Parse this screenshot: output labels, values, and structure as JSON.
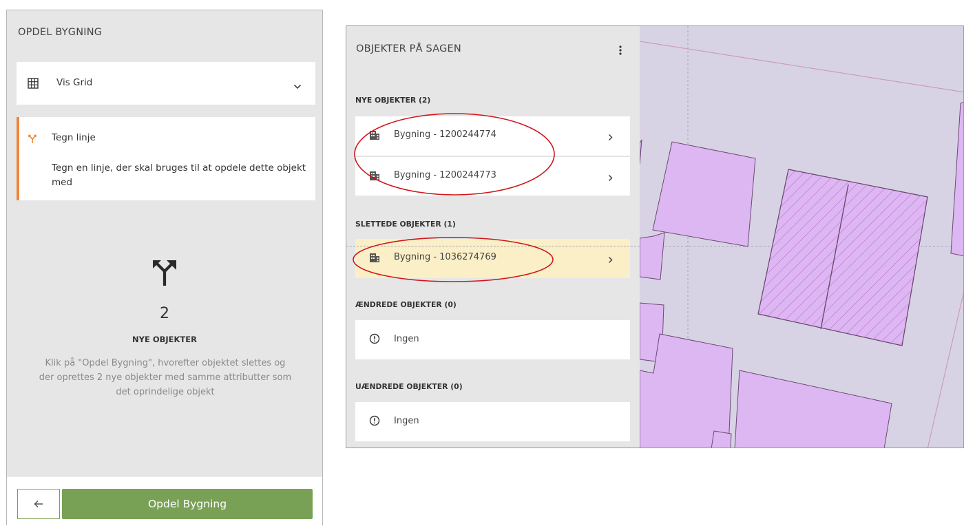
{
  "left_panel": {
    "title": "OPDEL BYGNING",
    "grid_selector": {
      "label": "Vis Grid",
      "icon": "grid-icon"
    },
    "draw_line": {
      "title": "Tegn linje",
      "description": "Tegn en linje, der skal bruges til at opdele dette objekt med",
      "accent_color": "#f0853a"
    },
    "new_count": "2",
    "new_count_label": "NYE OBJEKTER",
    "explanation": "Klik på \"Opdel Bygning\", hvorefter objektet slettes og der oprettes 2 nye objekter med samme attributter som det oprindelige objekt",
    "back_button_icon": "arrow-left-icon",
    "submit_button": "Opdel Bygning",
    "button_color": "#79a155"
  },
  "objects_panel": {
    "title": "OBJEKTER PÅ SAGEN",
    "sections": {
      "new": {
        "header": "NYE OBJEKTER (2)",
        "items": [
          "Bygning - 1200244774",
          "Bygning - 1200244773"
        ]
      },
      "deleted": {
        "header": "SLETTEDE OBJEKTER (1)",
        "items": [
          "Bygning - 1036274769"
        ]
      },
      "changed": {
        "header": "ÆNDREDE OBJEKTER (0)",
        "empty_text": "Ingen"
      },
      "unchanged": {
        "header": "UÆNDREDE OBJEKTER (0)",
        "empty_text": "Ingen"
      }
    }
  },
  "colors": {
    "map_background": "#d8d3e4",
    "building_fill": "#dcb7f2",
    "building_stroke": "#6b4a72",
    "hatch": "#c76ad6",
    "highlight_row": "#faefc6",
    "annotation_red": "#d0161b"
  }
}
